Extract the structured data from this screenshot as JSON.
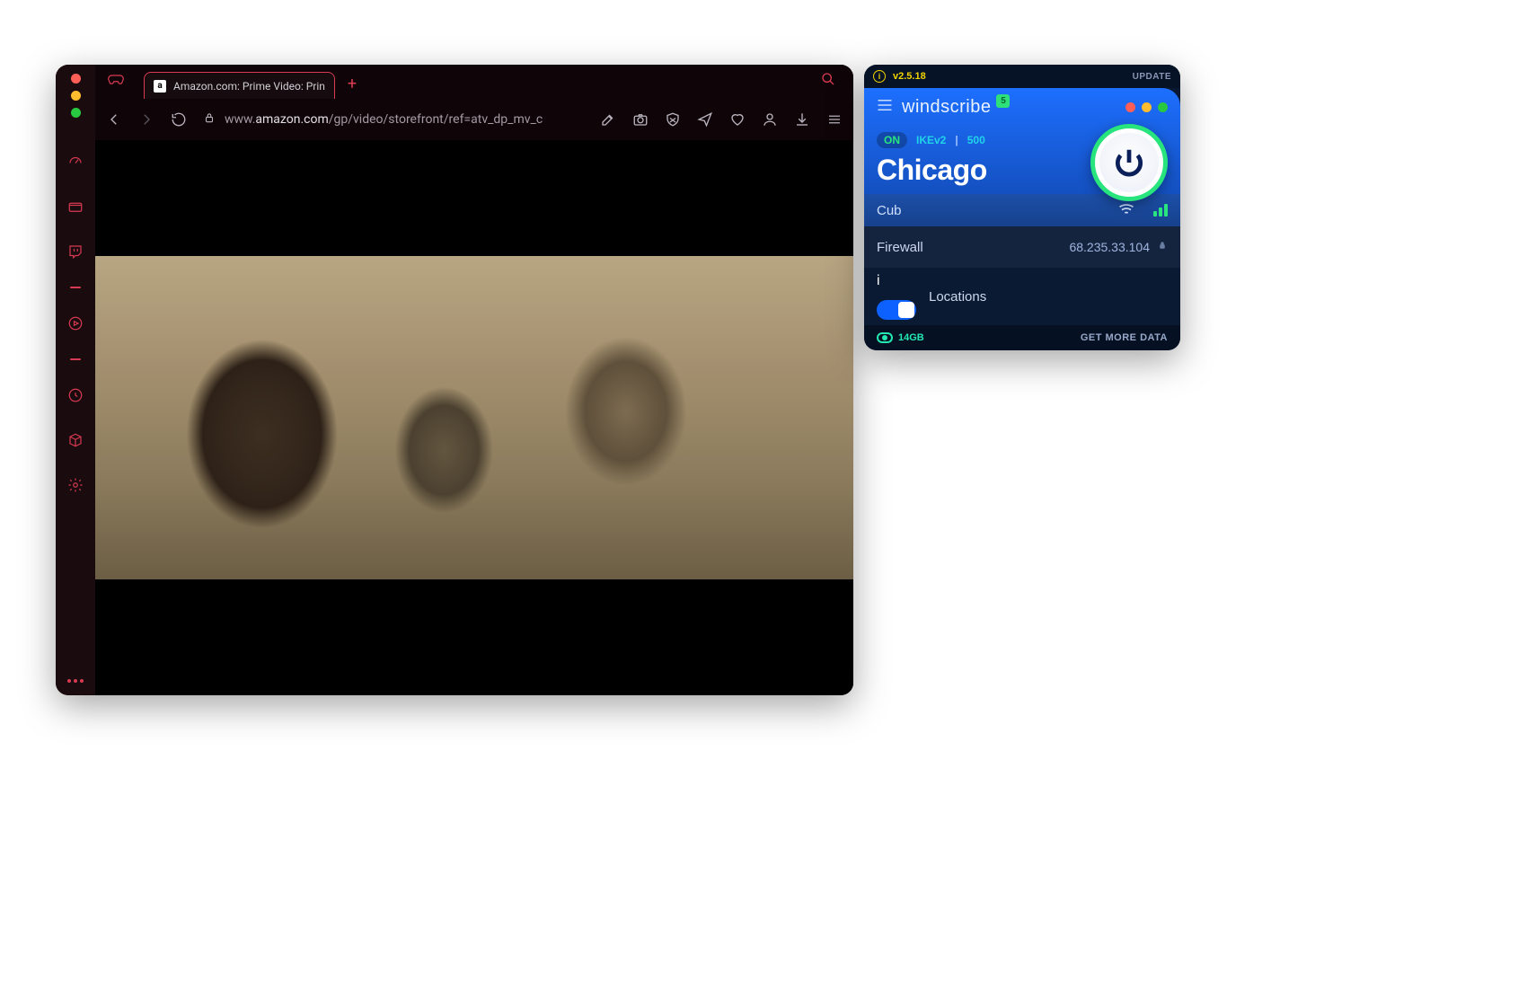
{
  "browser": {
    "tab": {
      "favicon_letter": "a",
      "title": "Amazon.com: Prime Video: Prin"
    },
    "addressbar": {
      "prefix": "www.",
      "host": "amazon.com",
      "path": "/gp/video/storefront/ref=atv_dp_mv_c"
    }
  },
  "vpn": {
    "version": "v2.5.18",
    "update_label": "UPDATE",
    "brand": "windscribe",
    "notif_count": "5",
    "status_on": "ON",
    "protocol": "IKEv2",
    "port": "500",
    "location": "Chicago",
    "sublocation": "Cub",
    "firewall_label": "Firewall",
    "ip": "68.235.33.104",
    "locations_label": "Locations",
    "data_remaining": "14GB",
    "get_more_label": "GET MORE DATA"
  }
}
